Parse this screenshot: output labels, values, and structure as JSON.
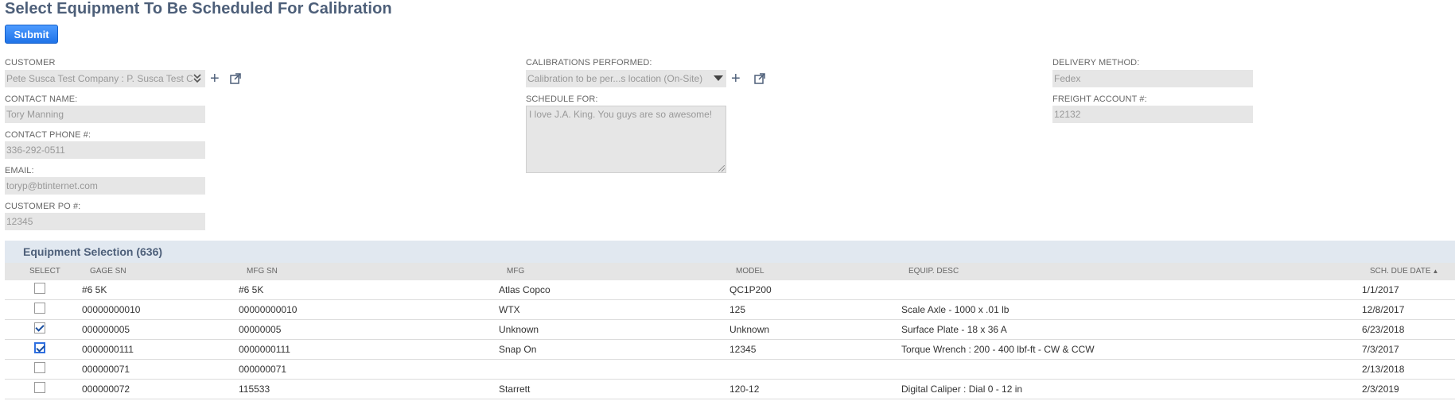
{
  "page": {
    "title": "Select Equipment To Be Scheduled For Calibration"
  },
  "toolbar": {
    "submit_label": "Submit"
  },
  "form": {
    "customer": {
      "label": "CUSTOMER",
      "value": "Pete Susca Test Company : P. Susca Test C"
    },
    "contact_name": {
      "label": "CONTACT NAME:",
      "value": "Tory Manning"
    },
    "contact_phone": {
      "label": "CONTACT PHONE #:",
      "value": "336-292-0511"
    },
    "email": {
      "label": "EMAIL:",
      "value": "toryp@btinternet.com"
    },
    "customer_po": {
      "label": "CUSTOMER PO #:",
      "value": "12345"
    },
    "calibrations_performed": {
      "label": "CALIBRATIONS PERFORMED:",
      "value": "Calibration to be per...s location (On-Site)"
    },
    "schedule_for": {
      "label": "SCHEDULE FOR:",
      "value": "I love J.A. King.  You guys are so awesome!"
    },
    "delivery_method": {
      "label": "DELIVERY METHOD:",
      "value": "Fedex"
    },
    "freight_account": {
      "label": "FREIGHT ACCOUNT #:",
      "value": "12132"
    }
  },
  "icons": {
    "plus": "+",
    "open": "open-external-icon"
  },
  "equipment": {
    "title": "Equipment Selection (636)",
    "columns": {
      "select": "SELECT",
      "gage_sn": "GAGE SN",
      "mfg_sn": "MFG SN",
      "mfg": "MFG",
      "model": "MODEL",
      "desc": "EQUIP. DESC",
      "due": "SCH. DUE DATE",
      "sort_indicator": "▲"
    },
    "rows": [
      {
        "checked": false,
        "focused": false,
        "gage_sn": "#6 5K",
        "mfg_sn": "#6 5K",
        "mfg": "Atlas Copco",
        "model": "QC1P200",
        "desc": "",
        "due": "1/1/2017"
      },
      {
        "checked": false,
        "focused": false,
        "gage_sn": "00000000010",
        "mfg_sn": "00000000010",
        "mfg": "WTX",
        "model": "125",
        "desc": "Scale Axle - 1000 x .01 lb",
        "due": "12/8/2017"
      },
      {
        "checked": true,
        "focused": false,
        "gage_sn": "000000005",
        "mfg_sn": "00000005",
        "mfg": "Unknown",
        "model": "Unknown",
        "desc": "Surface Plate - 18 x 36 A",
        "due": "6/23/2018"
      },
      {
        "checked": true,
        "focused": true,
        "gage_sn": "0000000111",
        "mfg_sn": "0000000111",
        "mfg": "Snap On",
        "model": "12345",
        "desc": "Torque Wrench : 200 - 400 lbf-ft - CW & CCW",
        "due": "7/3/2017"
      },
      {
        "checked": false,
        "focused": false,
        "gage_sn": "000000071",
        "mfg_sn": "000000071",
        "mfg": "",
        "model": "",
        "desc": "",
        "due": "2/13/2018"
      },
      {
        "checked": false,
        "focused": false,
        "gage_sn": "000000072",
        "mfg_sn": "115533",
        "mfg": "Starrett",
        "model": "120-12",
        "desc": "Digital Caliper : Dial 0 - 12 in",
        "due": "2/3/2019"
      }
    ]
  },
  "colors": {
    "accent": "#1f73e8",
    "title": "#4d5f79",
    "field_bg": "#e6e6e6",
    "section_bg": "#e1e8f0"
  }
}
